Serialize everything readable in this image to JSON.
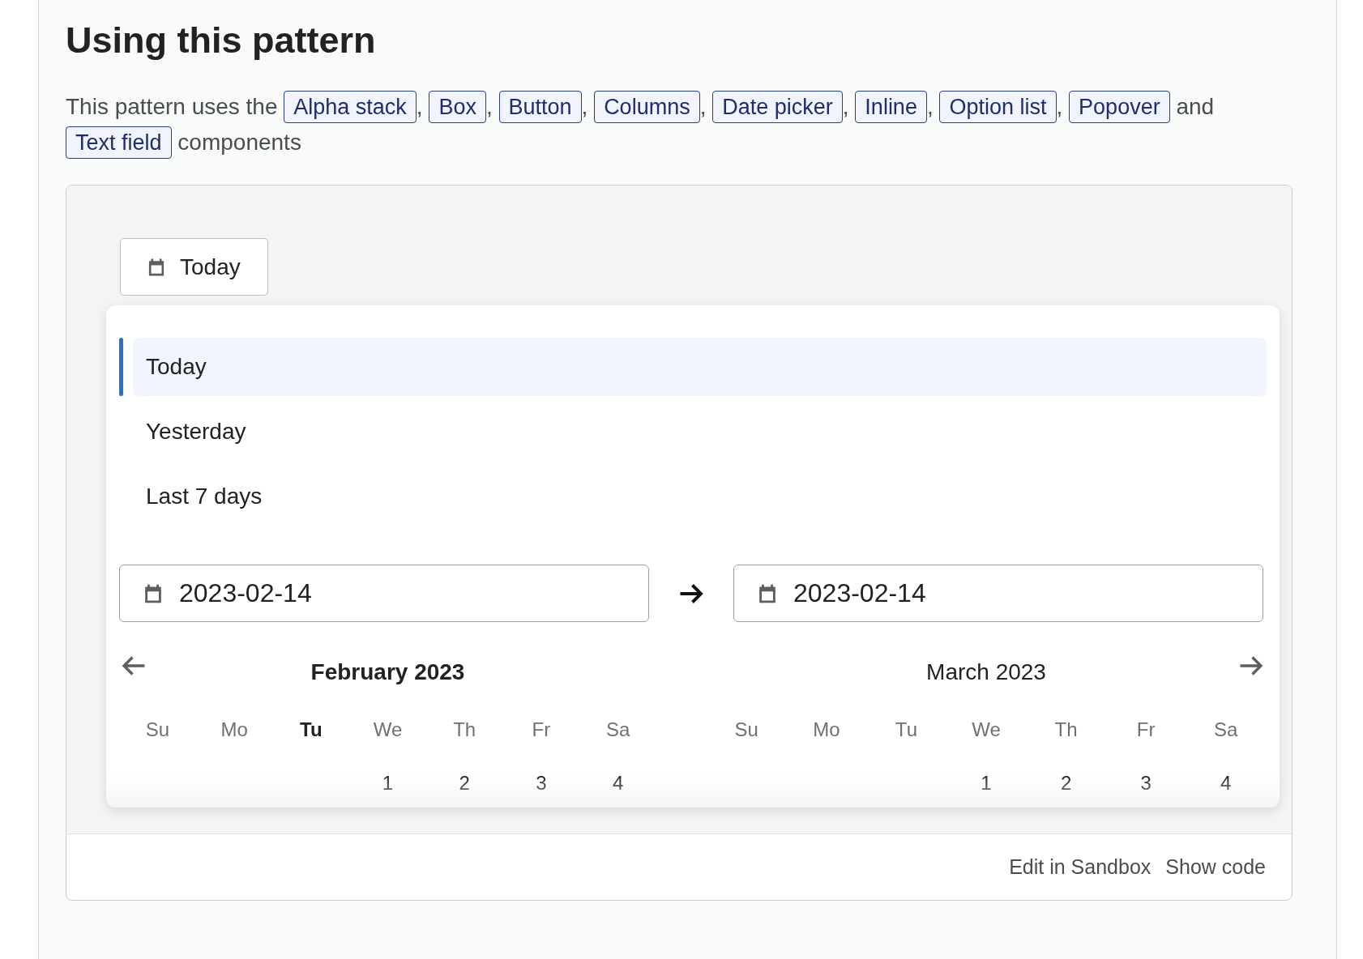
{
  "heading": "Using this pattern",
  "intro": [
    {
      "kind": "text",
      "text": "This pattern uses the"
    },
    {
      "kind": "tag",
      "text": "Alpha stack"
    },
    {
      "kind": "text",
      "text": ","
    },
    {
      "kind": "tag",
      "text": "Box"
    },
    {
      "kind": "text",
      "text": ","
    },
    {
      "kind": "tag",
      "text": "Button"
    },
    {
      "kind": "text",
      "text": ","
    },
    {
      "kind": "tag",
      "text": "Columns"
    },
    {
      "kind": "text",
      "text": ","
    },
    {
      "kind": "tag",
      "text": "Date picker"
    },
    {
      "kind": "text",
      "text": ","
    },
    {
      "kind": "tag",
      "text": "Inline"
    },
    {
      "kind": "text",
      "text": ","
    },
    {
      "kind": "tag",
      "text": "Option list"
    },
    {
      "kind": "text",
      "text": ","
    },
    {
      "kind": "tag",
      "text": "Popover"
    },
    {
      "kind": "text",
      "text": "and"
    },
    {
      "kind": "tag",
      "text": "Text field"
    },
    {
      "kind": "text",
      "text": "components"
    }
  ],
  "trigger": {
    "label": "Today"
  },
  "options": [
    {
      "label": "Today",
      "selected": true
    },
    {
      "label": "Yesterday",
      "selected": false
    },
    {
      "label": "Last 7 days",
      "selected": false
    }
  ],
  "start_field": {
    "value": "2023-02-14"
  },
  "end_field": {
    "value": "2023-02-14"
  },
  "months": [
    {
      "title": "February 2023",
      "current": true,
      "weekdays": [
        {
          "label": "Su",
          "today": false
        },
        {
          "label": "Mo",
          "today": false
        },
        {
          "label": "Tu",
          "today": true
        },
        {
          "label": "We",
          "today": false
        },
        {
          "label": "Th",
          "today": false
        },
        {
          "label": "Fr",
          "today": false
        },
        {
          "label": "Sa",
          "today": false
        }
      ],
      "days": [
        {
          "kind": "blank"
        },
        {
          "kind": "blank"
        },
        {
          "kind": "blank"
        },
        {
          "kind": "day",
          "label": "1"
        },
        {
          "kind": "day",
          "label": "2"
        },
        {
          "kind": "day",
          "label": "3"
        },
        {
          "kind": "day",
          "label": "4"
        }
      ]
    },
    {
      "title": "March 2023",
      "current": false,
      "weekdays": [
        {
          "label": "Su",
          "today": false
        },
        {
          "label": "Mo",
          "today": false
        },
        {
          "label": "Tu",
          "today": false
        },
        {
          "label": "We",
          "today": false
        },
        {
          "label": "Th",
          "today": false
        },
        {
          "label": "Fr",
          "today": false
        },
        {
          "label": "Sa",
          "today": false
        }
      ],
      "days": [
        {
          "kind": "blank"
        },
        {
          "kind": "blank"
        },
        {
          "kind": "blank"
        },
        {
          "kind": "day",
          "label": "1"
        },
        {
          "kind": "day",
          "label": "2"
        },
        {
          "kind": "day",
          "label": "3"
        },
        {
          "kind": "day",
          "label": "4"
        }
      ]
    }
  ],
  "footer_links": [
    "Edit in Sandbox",
    "Show code"
  ]
}
